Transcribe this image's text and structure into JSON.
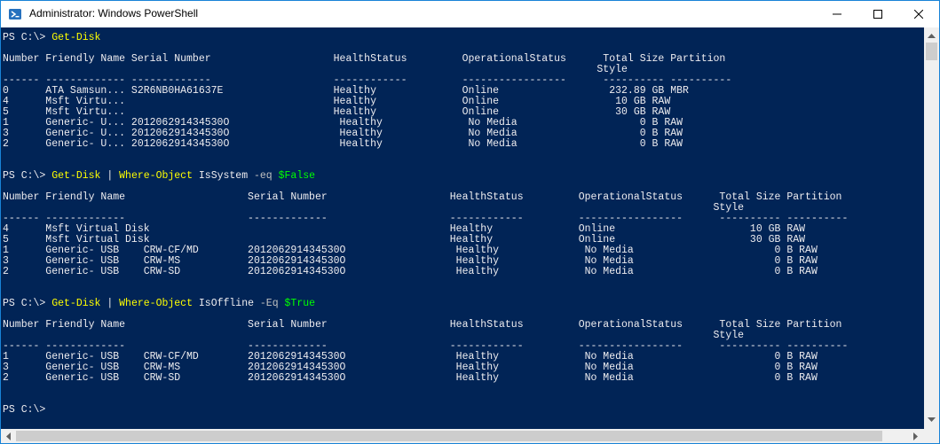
{
  "window": {
    "title": "Administrator: Windows PowerShell",
    "icon": "powershell-icon",
    "controls": [
      "minimize-icon",
      "maximize-icon",
      "close-icon"
    ]
  },
  "colors": {
    "console_bg": "#012456",
    "text": "#eeedf0",
    "command": "#ffff00",
    "parameter": "#c0c0c0",
    "variable": "#00ff00"
  },
  "console": {
    "lines": [
      {
        "segments": [
          {
            "text": "PS C:\\> ",
            "kind": "text"
          },
          {
            "text": "Get-Disk",
            "kind": "cmd"
          }
        ]
      },
      {
        "segments": [
          {
            "text": "Number Friendly Name Serial Number                    HealthStatus         OperationalStatus      Total Size Partition",
            "kind": "text"
          }
        ]
      },
      {
        "segments": [
          {
            "text": "                                                                                                 Style",
            "kind": "text"
          }
        ]
      },
      {
        "segments": [
          {
            "text": "------ ------------- -------------                    ------------         -----------------      ---------- ----------",
            "kind": "text"
          }
        ]
      },
      {
        "segments": [
          {
            "text": "0      ATA Samsun... S2R6NB0HA61637E                  Healthy              Online                  232.89 GB MBR",
            "kind": "text"
          }
        ]
      },
      {
        "segments": [
          {
            "text": "4      Msft Virtu...                                  Healthy              Online                   10 GB RAW",
            "kind": "text"
          }
        ]
      },
      {
        "segments": [
          {
            "text": "5      Msft Virtu...                                  Healthy              Online                   30 GB RAW",
            "kind": "text"
          }
        ]
      },
      {
        "segments": [
          {
            "text": "1      Generic- U... 201206291434530O                  Healthy              No Media                    0 B RAW",
            "kind": "text"
          }
        ]
      },
      {
        "segments": [
          {
            "text": "3      Generic- U... 201206291434530O                  Healthy              No Media                    0 B RAW",
            "kind": "text"
          }
        ]
      },
      {
        "segments": [
          {
            "text": "2      Generic- U... 201206291434530O                  Healthy              No Media                    0 B RAW",
            "kind": "text"
          }
        ]
      },
      {
        "segments": [
          {
            "text": "PS C:\\> ",
            "kind": "text"
          },
          {
            "text": "Get-Disk",
            "kind": "cmd"
          },
          {
            "text": " | ",
            "kind": "text"
          },
          {
            "text": "Where-Object",
            "kind": "cmd"
          },
          {
            "text": " IsSystem ",
            "kind": "text"
          },
          {
            "text": "-eq",
            "kind": "param"
          },
          {
            "text": " ",
            "kind": "text"
          },
          {
            "text": "$False",
            "kind": "var"
          }
        ]
      },
      {
        "segments": [
          {
            "text": "Number Friendly Name                    Serial Number                    HealthStatus         OperationalStatus      Total Size Partition",
            "kind": "text"
          }
        ]
      },
      {
        "segments": [
          {
            "text": "                                                                                                                    Style",
            "kind": "text"
          }
        ]
      },
      {
        "segments": [
          {
            "text": "------ -------------                    -------------                    ------------         -----------------      ---------- ----------",
            "kind": "text"
          }
        ]
      },
      {
        "segments": [
          {
            "text": "4      Msft Virtual Disk                                                 Healthy              Online                      10 GB RAW",
            "kind": "text"
          }
        ]
      },
      {
        "segments": [
          {
            "text": "5      Msft Virtual Disk                                                 Healthy              Online                      30 GB RAW",
            "kind": "text"
          }
        ]
      },
      {
        "segments": [
          {
            "text": "1      Generic- USB    CRW-CF/MD        201206291434530O                  Healthy              No Media                       0 B RAW",
            "kind": "text"
          }
        ]
      },
      {
        "segments": [
          {
            "text": "3      Generic- USB    CRW-MS           201206291434530O                  Healthy              No Media                       0 B RAW",
            "kind": "text"
          }
        ]
      },
      {
        "segments": [
          {
            "text": "2      Generic- USB    CRW-SD           201206291434530O                  Healthy              No Media                       0 B RAW",
            "kind": "text"
          }
        ]
      },
      {
        "segments": [
          {
            "text": "PS C:\\> ",
            "kind": "text"
          },
          {
            "text": "Get-Disk",
            "kind": "cmd"
          },
          {
            "text": " | ",
            "kind": "text"
          },
          {
            "text": "Where-Object",
            "kind": "cmd"
          },
          {
            "text": " IsOffline ",
            "kind": "text"
          },
          {
            "text": "-Eq",
            "kind": "param"
          },
          {
            "text": " ",
            "kind": "text"
          },
          {
            "text": "$True",
            "kind": "var"
          }
        ]
      },
      {
        "segments": [
          {
            "text": "Number Friendly Name                    Serial Number                    HealthStatus         OperationalStatus      Total Size Partition",
            "kind": "text"
          }
        ]
      },
      {
        "segments": [
          {
            "text": "                                                                                                                    Style",
            "kind": "text"
          }
        ]
      },
      {
        "segments": [
          {
            "text": "------ -------------                    -------------                    ------------         -----------------      ---------- ----------",
            "kind": "text"
          }
        ]
      },
      {
        "segments": [
          {
            "text": "1      Generic- USB    CRW-CF/MD        201206291434530O                  Healthy              No Media                       0 B RAW",
            "kind": "text"
          }
        ]
      },
      {
        "segments": [
          {
            "text": "3      Generic- USB    CRW-MS           201206291434530O                  Healthy              No Media                       0 B RAW",
            "kind": "text"
          }
        ]
      },
      {
        "segments": [
          {
            "text": "2      Generic- USB    CRW-SD           201206291434530O                  Healthy              No Media                       0 B RAW",
            "kind": "text"
          }
        ]
      },
      {
        "segments": [
          {
            "text": "PS C:\\>",
            "kind": "text"
          }
        ]
      }
    ]
  }
}
